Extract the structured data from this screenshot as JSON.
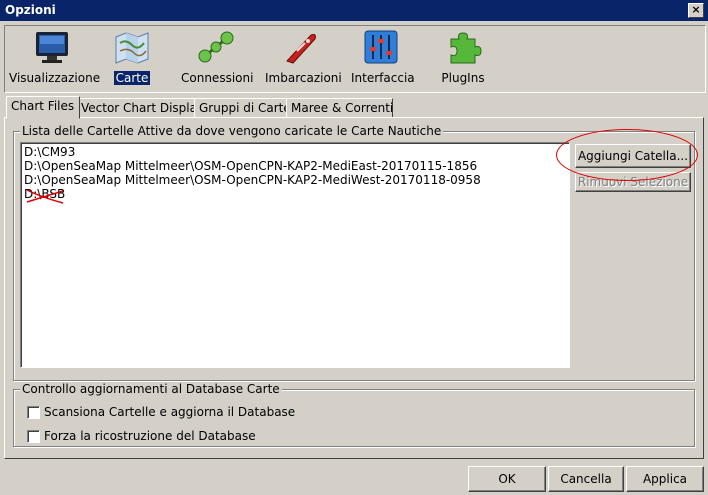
{
  "window": {
    "title": "Opzioni",
    "close_glyph": "×"
  },
  "toolbar": {
    "items": [
      {
        "label": "Visualizzazione",
        "icon": "monitor-icon"
      },
      {
        "label": "Carte",
        "icon": "chart-map-icon",
        "selected": true
      },
      {
        "label": "Connessioni",
        "icon": "connections-icon"
      },
      {
        "label": "Imbarcazioni",
        "icon": "boat-icon"
      },
      {
        "label": "Interfaccia",
        "icon": "sliders-icon"
      },
      {
        "label": "PlugIns",
        "icon": "puzzle-icon"
      }
    ]
  },
  "tabs": [
    {
      "label": "Chart Files",
      "active": true
    },
    {
      "label": "Vector Chart Display"
    },
    {
      "label": "Gruppi di Carte"
    },
    {
      "label": "Maree & Correnti"
    }
  ],
  "chart_dirs": {
    "group_title": "Lista delle Cartelle Attive da dove vengono caricate le Carte Nautiche",
    "items": [
      "D:\\CM93",
      "D:\\OpenSeaMap Mittelmeer\\OSM-OpenCPN-KAP2-MediEast-20170115-1856",
      "D:\\OpenSeaMap Mittelmeer\\OSM-OpenCPN-KAP2-MediWest-20170118-0958",
      "D:\\BSB"
    ],
    "add_button": "Aggiungi Catella...",
    "remove_button": "Rimuovi Selezione"
  },
  "db_update": {
    "group_title": "Controllo aggiornamenti al Database Carte",
    "scan_label": "Scansiona Cartelle e aggiorna il Database",
    "rebuild_label": "Forza la ricostruzione del Database",
    "scan_checked": false,
    "rebuild_checked": false
  },
  "footer": {
    "ok": "OK",
    "cancel": "Cancella",
    "apply": "Applica"
  },
  "colors": {
    "titlebar": "#0a246a",
    "face": "#d4d0c8",
    "annotation": "#e00000"
  }
}
